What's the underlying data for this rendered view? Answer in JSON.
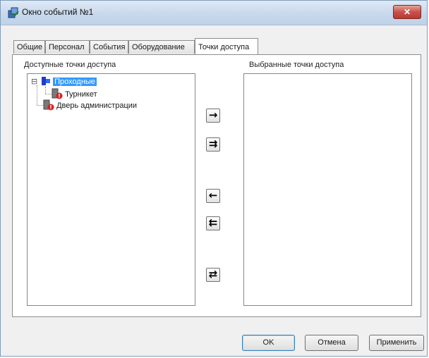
{
  "window": {
    "title": "Окно событий №1",
    "close_label": "✕"
  },
  "tabs": [
    {
      "label": "Общие",
      "active": false
    },
    {
      "label": "Персонал",
      "active": false
    },
    {
      "label": "События",
      "active": false
    },
    {
      "label": "Оборудование",
      "active": false
    },
    {
      "label": "Точки доступа",
      "active": true
    }
  ],
  "available": {
    "label": "Доступные точки доступа",
    "items": [
      {
        "label": "Проходные",
        "selected": true,
        "expanded": true,
        "expander": "⊟"
      },
      {
        "label": "Турникет",
        "selected": false
      },
      {
        "label": "Дверь администрации",
        "selected": false
      }
    ]
  },
  "selected": {
    "label": "Выбранные точки доступа",
    "items": []
  },
  "transfer_buttons": {
    "add_one": "→",
    "add_all": "⇉",
    "remove_one": "←",
    "remove_all": "⇇",
    "swap": "⇄"
  },
  "footer": {
    "ok_label": "OK",
    "cancel_label": "Отмена",
    "apply_label": "Применить"
  },
  "colors": {
    "selection": "#3399ff",
    "close_button": "#c75050"
  }
}
